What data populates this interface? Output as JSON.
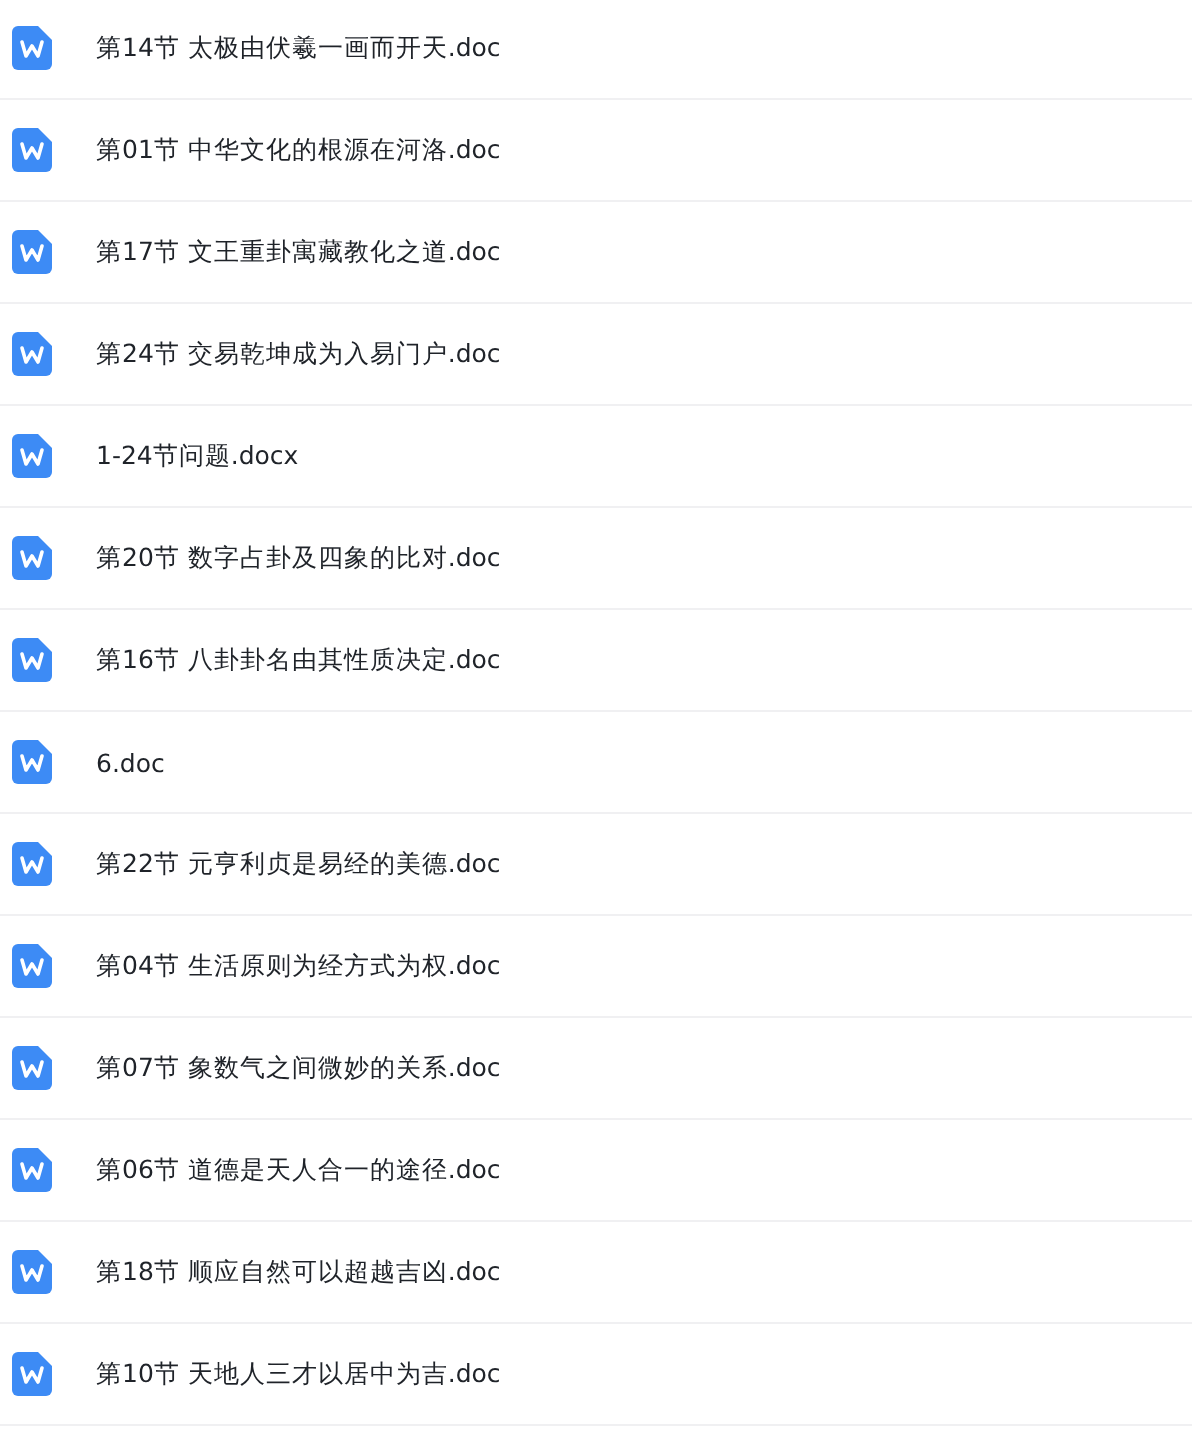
{
  "files": [
    {
      "name": "第14节 太极由伏羲一画而开天.doc"
    },
    {
      "name": "第01节 中华文化的根源在河洛.doc"
    },
    {
      "name": "第17节 文王重卦寓藏教化之道.doc"
    },
    {
      "name": "第24节 交易乾坤成为入易门户.doc"
    },
    {
      "name": "1-24节问题.docx"
    },
    {
      "name": "第20节 数字占卦及四象的比对.doc"
    },
    {
      "name": "第16节 八卦卦名由其性质决定.doc"
    },
    {
      "name": "6.doc"
    },
    {
      "name": "第22节 元亨利贞是易经的美德.doc"
    },
    {
      "name": "第04节 生活原则为经方式为权.doc"
    },
    {
      "name": "第07节 象数气之间微妙的关系.doc"
    },
    {
      "name": "第06节 道德是天人合一的途径.doc"
    },
    {
      "name": "第18节 顺应自然可以超越吉凶.doc"
    },
    {
      "name": "第10节 天地人三才以居中为吉.doc"
    }
  ]
}
